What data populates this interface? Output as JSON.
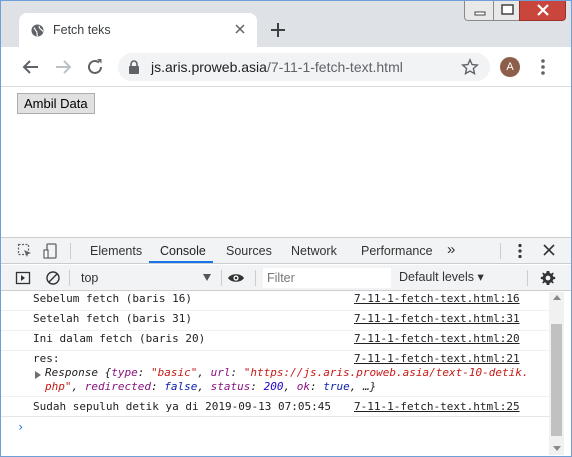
{
  "browser": {
    "tab_title": "Fetch teks",
    "url_host": "js.aris.proweb.asia",
    "url_path": "/7-11-1-fetch-text.html",
    "avatar_letter": "A",
    "icons": [
      "globe-icon",
      "close-icon",
      "plus-icon",
      "back-arrow-icon",
      "forward-arrow-icon",
      "reload-icon",
      "lock-icon",
      "star-icon",
      "kebab-menu-icon"
    ]
  },
  "page": {
    "button_label": "Ambil Data"
  },
  "devtools": {
    "tabs": [
      "Elements",
      "Console",
      "Sources",
      "Network",
      "Performance"
    ],
    "active_tab": "Console",
    "more_tabs": "»",
    "context": "top",
    "filter_placeholder": "Filter",
    "levels": "Default levels ▾",
    "accent": "#1a73e8"
  },
  "console": {
    "rows": [
      {
        "msg": "Sebelum fetch (baris 16)",
        "src": "7-11-1-fetch-text.html:16"
      },
      {
        "msg": "Setelah fetch (baris 31)",
        "src": "7-11-1-fetch-text.html:31"
      },
      {
        "msg": "Ini dalam fetch (baris 20)",
        "src": "7-11-1-fetch-text.html:20"
      },
      {
        "msg": "res:",
        "src": "7-11-1-fetch-text.html:21"
      },
      {
        "msg": "Sudah sepuluh detik ya di 2019-09-13 07:05:45",
        "src": "7-11-1-fetch-text.html:25"
      }
    ],
    "response_obj": {
      "prefix": "Response {",
      "type_key": "type",
      "type_val": "\"basic\"",
      "url_key": "url",
      "url_val_line1": "\"https://js.aris.proweb.asia/text-10-detik.",
      "url_val_line2": "php\"",
      "redirected_key": "redirected",
      "redirected_val": "false",
      "status_key": "status",
      "status_val": "200",
      "ok_key": "ok",
      "ok_val": "true",
      "suffix": ", …}"
    },
    "prompt": "›"
  }
}
